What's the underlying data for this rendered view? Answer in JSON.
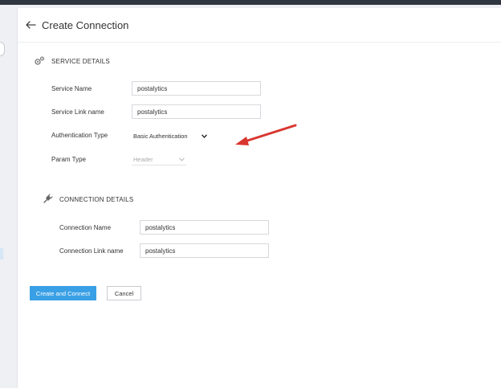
{
  "header": {
    "title": "Create Connection"
  },
  "service_details": {
    "heading": "SERVICE DETAILS",
    "service_name": {
      "label": "Service Name",
      "value": "postalytics"
    },
    "service_link_name": {
      "label": "Service Link name",
      "value": "postalytics"
    },
    "authentication_type": {
      "label": "Authentication Type",
      "selected": "Basic Authentication"
    },
    "param_type": {
      "label": "Param Type",
      "selected": "Header"
    }
  },
  "connection_details": {
    "heading": "CONNECTION DETAILS",
    "connection_name": {
      "label": "Connection Name",
      "value": "postalytics"
    },
    "connection_link_name": {
      "label": "Connection Link name",
      "value": "postalytics"
    }
  },
  "actions": {
    "create_label": "Create and Connect",
    "cancel_label": "Cancel"
  },
  "colors": {
    "primary": "#3aa0e6",
    "annotation_arrow": "#d9362f"
  }
}
